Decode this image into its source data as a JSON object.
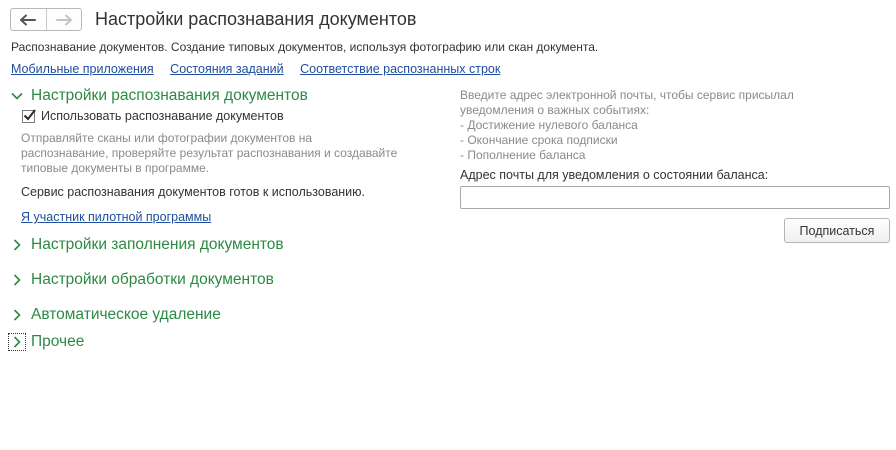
{
  "header": {
    "title": "Настройки распознавания документов",
    "description": "Распознавание документов. Создание типовых документов, используя фотографию или скан документа."
  },
  "links": [
    "Мобильные приложения",
    "Состояния заданий",
    "Соответствие распознанных строк"
  ],
  "groups": {
    "recognition": {
      "label": "Настройки распознавания документов",
      "checkbox_label": "Использовать распознавание документов",
      "checkbox_checked": true,
      "hint": "Отправляйте сканы или фотографии документов на распознавание, проверяйте результат распознавания и создавайте типовые документы в программе.",
      "status": "Сервис распознавания документов готов к использованию.",
      "pilot_link": "Я участник пилотной программы"
    },
    "filling": {
      "label": "Настройки заполнения документов"
    },
    "processing": {
      "label": "Настройки обработки документов"
    },
    "auto_delete": {
      "label": "Автоматическое удаление"
    },
    "other": {
      "label": "Прочее"
    }
  },
  "notifications": {
    "intro": "Введите адрес электронной почты, чтобы сервис присылал уведомления о важных событиях:",
    "events": [
      "- Достижение нулевого баланса",
      "- Окончание срока подписки",
      "- Пополнение баланса"
    ],
    "email_label": "Адрес почты для уведомления о состоянии баланса:",
    "email_value": "",
    "subscribe_label": "Подписаться"
  },
  "colors": {
    "group_title": "#2c8a43",
    "link": "#1f4e9e",
    "hint": "#8a8a8a"
  }
}
